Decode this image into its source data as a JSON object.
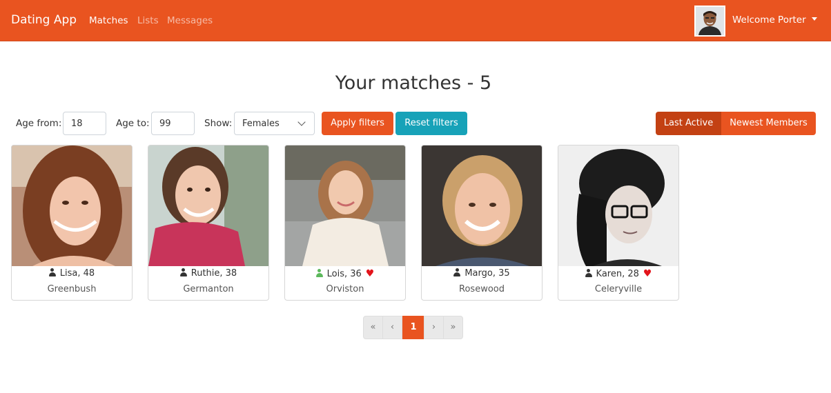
{
  "navbar": {
    "brand": "Dating App",
    "links": [
      "Matches",
      "Lists",
      "Messages"
    ],
    "welcome": "Welcome Porter",
    "accent": "#e95420"
  },
  "title": "Your matches - 5",
  "filters": {
    "age_from_label": "Age from:",
    "age_from_value": "18",
    "age_to_label": "Age to:",
    "age_to_value": "99",
    "show_label": "Show:",
    "show_value": "Females",
    "apply_label": "Apply filters",
    "reset_label": "Reset filters",
    "sort_last_active": "Last Active",
    "sort_newest": "Newest Members"
  },
  "members": [
    {
      "name_age": "Lisa, 48",
      "city": "Greenbush",
      "liked": false,
      "online": false
    },
    {
      "name_age": "Ruthie, 38",
      "city": "Germanton",
      "liked": false,
      "online": false
    },
    {
      "name_age": "Lois, 36",
      "city": "Orviston",
      "liked": true,
      "online": true
    },
    {
      "name_age": "Margo, 35",
      "city": "Rosewood",
      "liked": false,
      "online": false
    },
    {
      "name_age": "Karen, 28",
      "city": "Celeryville",
      "liked": true,
      "online": false
    }
  ],
  "pagination": {
    "first": "«",
    "prev": "‹",
    "current": "1",
    "next": "›",
    "last": "»"
  }
}
